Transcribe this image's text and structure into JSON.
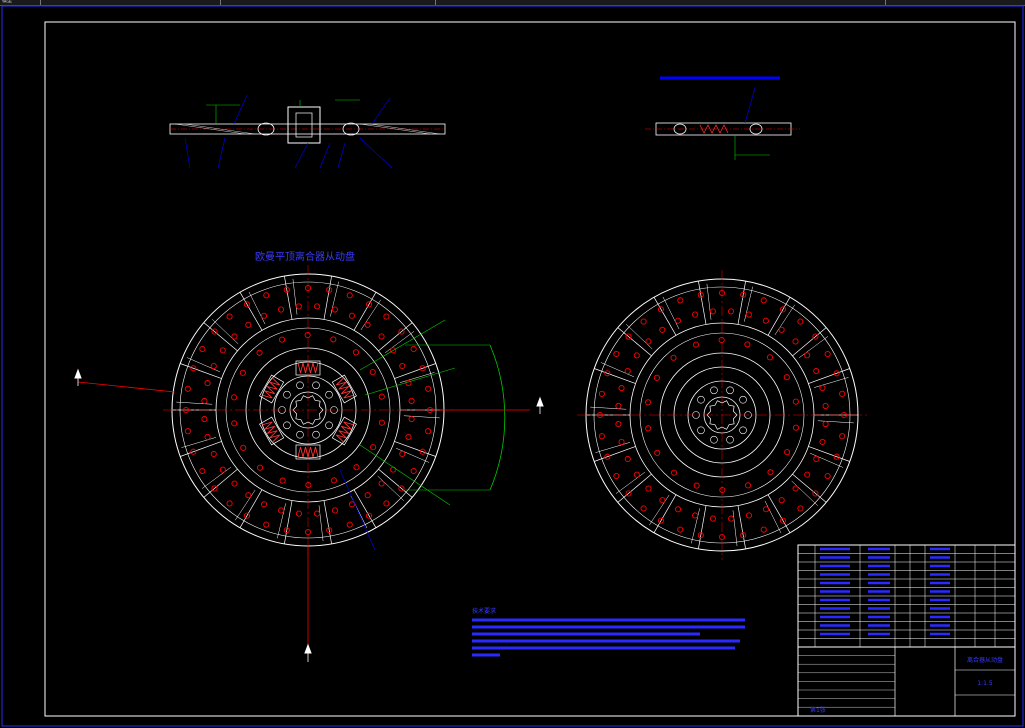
{
  "window": {
    "tab_label": "模型"
  },
  "drawing": {
    "title": "欧曼平顶离合器从动盘",
    "tech_heading": "技术要求",
    "title_block_name": "离合器从动盘",
    "scale_label": "1:1.5",
    "sheet_label": "第1张"
  },
  "colors": {
    "background": "#000000",
    "frame": "#ffffff",
    "geometry": "#ffffff",
    "centerline": "#ff0000",
    "dimension": "#00cc00",
    "annotation": "#0000ff",
    "spring": "#ff3333"
  }
}
